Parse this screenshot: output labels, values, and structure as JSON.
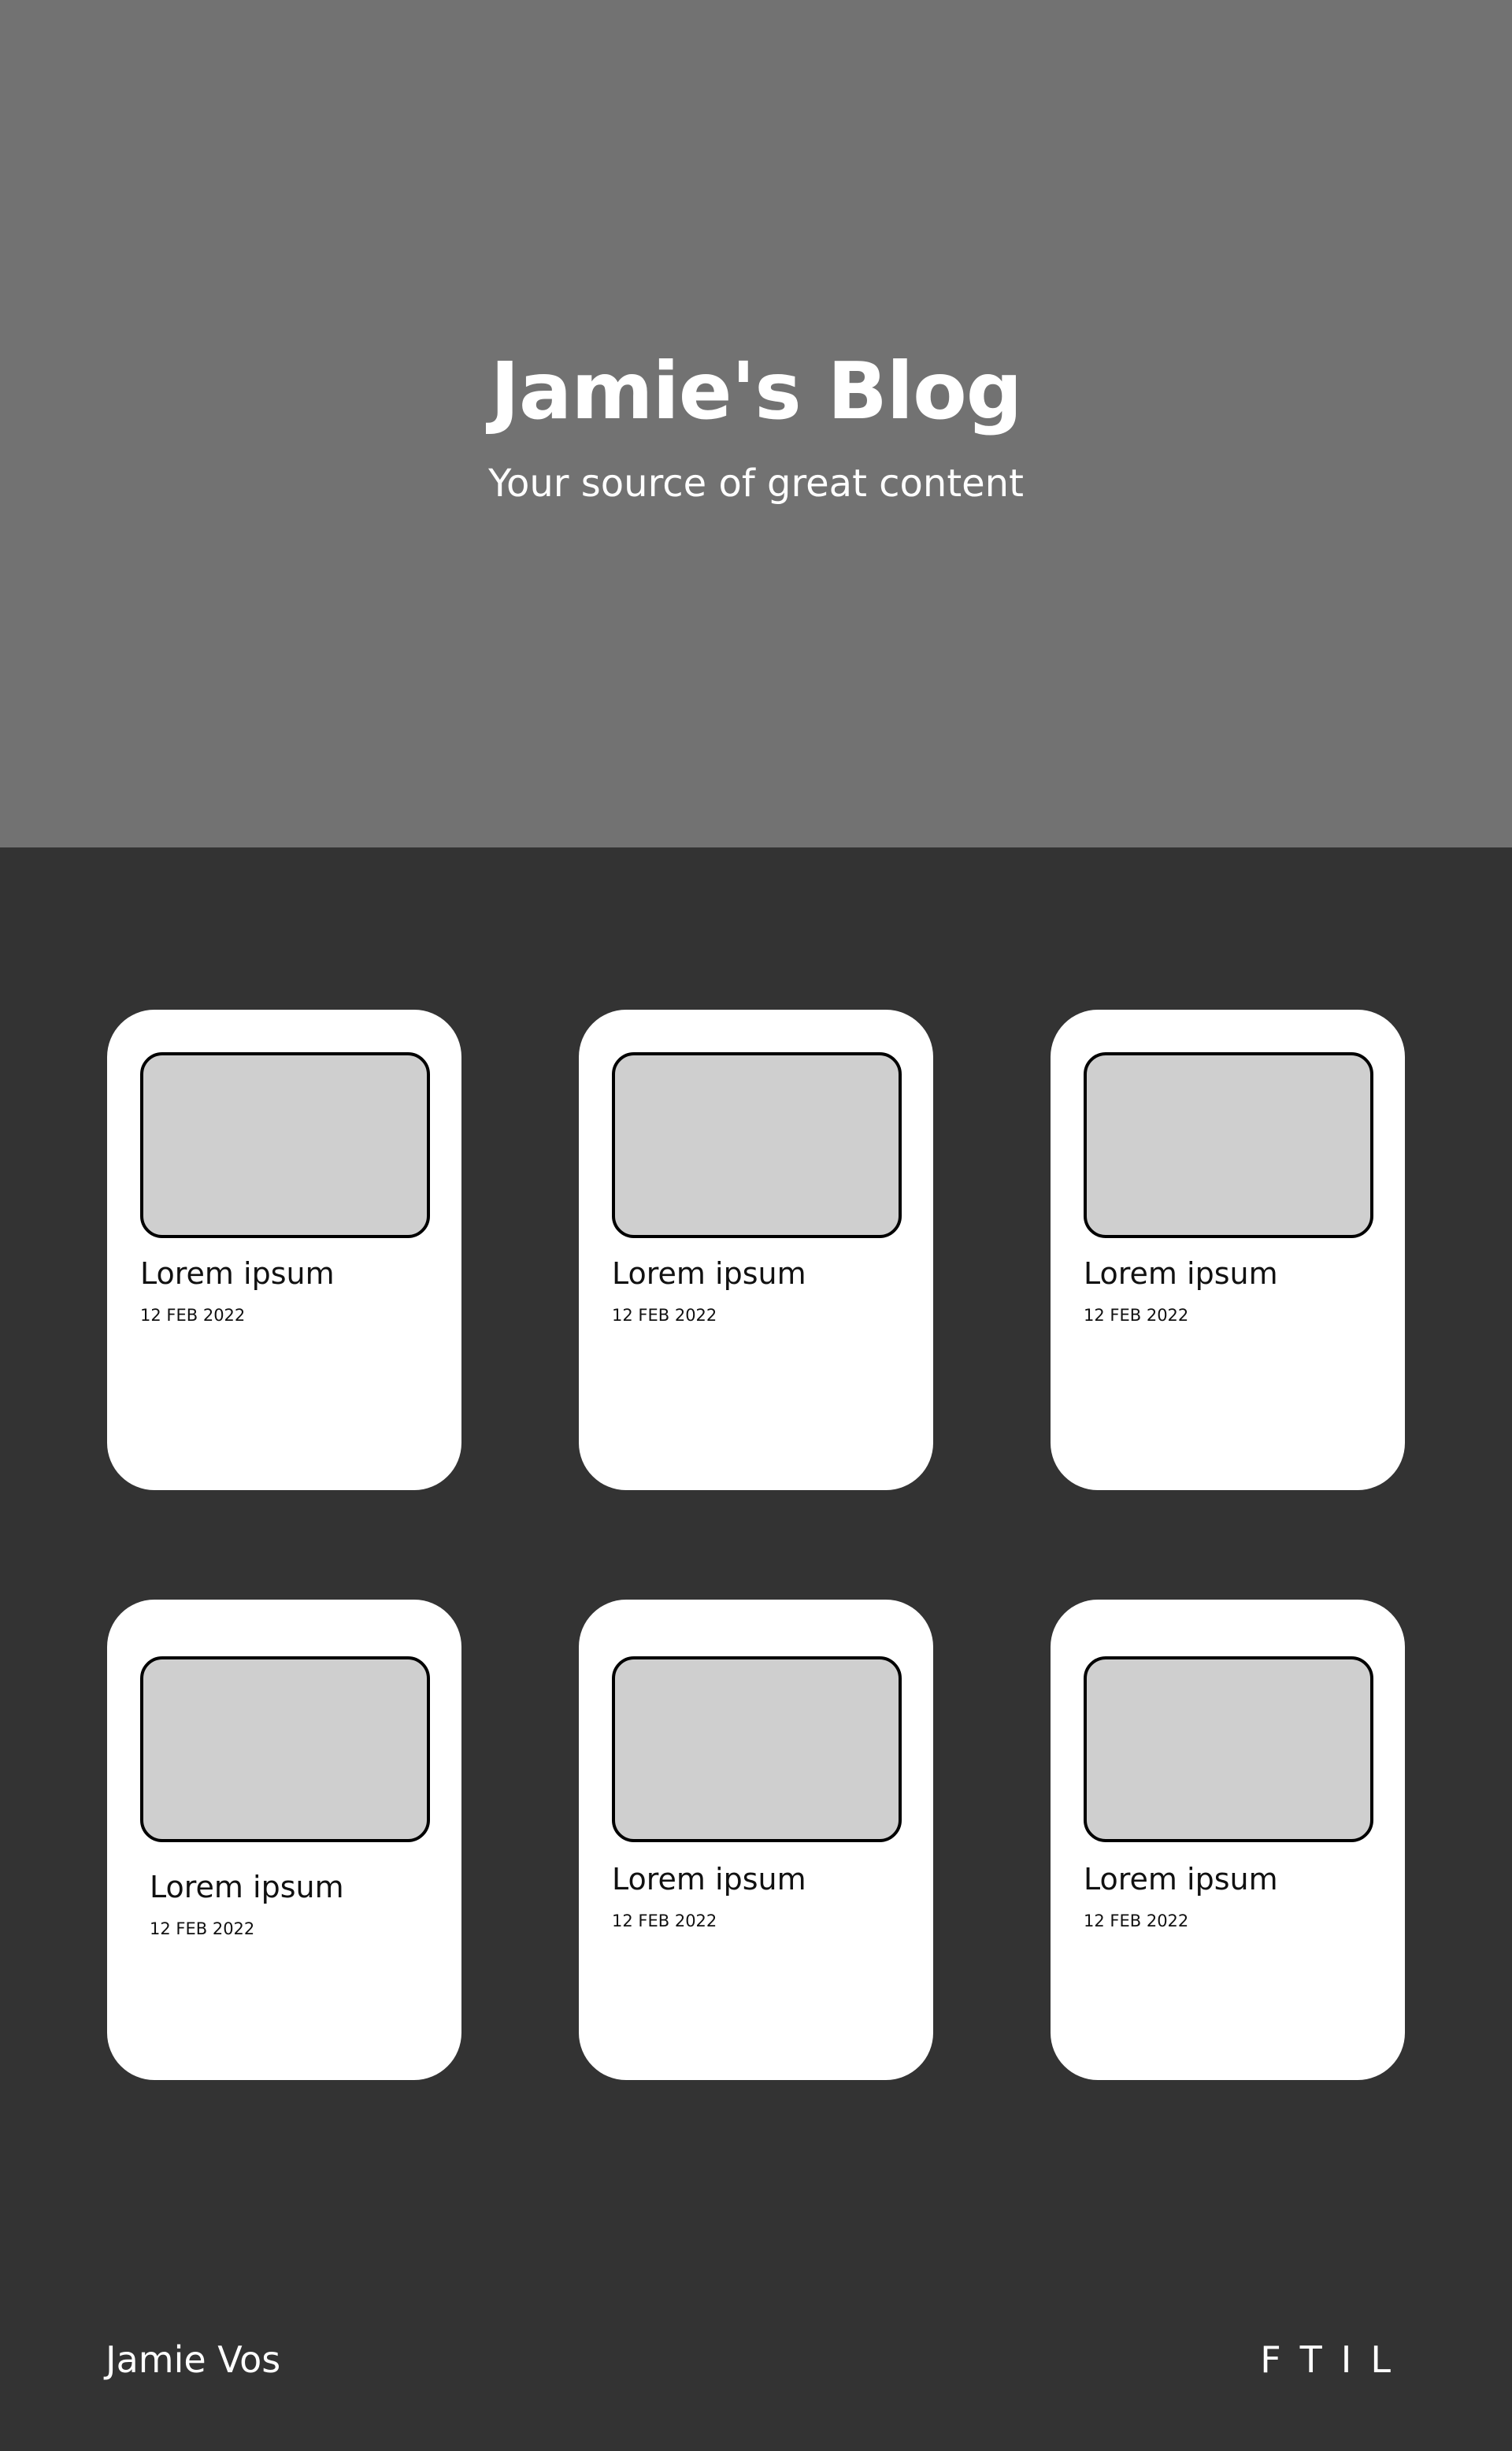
{
  "hero": {
    "title": "Jamie's Blog",
    "subtitle": "Your source of great content"
  },
  "posts": [
    {
      "title": "Lorem ipsum",
      "date": "12 FEB 2022"
    },
    {
      "title": "Lorem ipsum",
      "date": "12 FEB 2022"
    },
    {
      "title": "Lorem ipsum",
      "date": "12 FEB 2022"
    },
    {
      "title": "Lorem ipsum",
      "date": "12 FEB 2022"
    },
    {
      "title": "Lorem ipsum",
      "date": "12 FEB 2022"
    },
    {
      "title": "Lorem ipsum",
      "date": "12 FEB 2022"
    }
  ],
  "footer": {
    "name": "Jamie Vos",
    "social_links": [
      "F",
      "T",
      "I",
      "L"
    ]
  },
  "colors": {
    "hero_bg": "#727272",
    "page_bg": "#333333",
    "card_bg": "#ffffff",
    "thumb_bg": "#cfcfcf"
  }
}
